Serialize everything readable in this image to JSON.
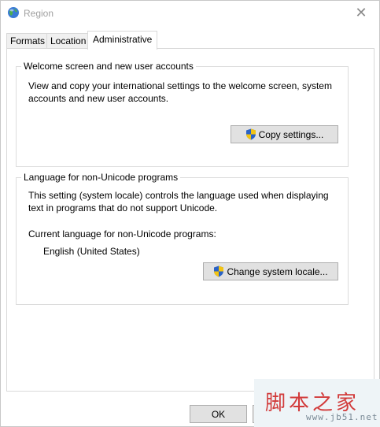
{
  "window": {
    "title": "Region",
    "close_symbol": "✕"
  },
  "tabs": [
    {
      "label": "Formats",
      "active": false
    },
    {
      "label": "Location",
      "active": false
    },
    {
      "label": "Administrative",
      "active": true
    }
  ],
  "welcome_group": {
    "title": "Welcome screen and new user accounts",
    "description_line1": "View and copy your international settings to the welcome screen, system",
    "description_line2": "accounts and new user accounts.",
    "copy_button_label": "Copy settings..."
  },
  "nonunicode_group": {
    "title": "Language for non-Unicode programs",
    "description_line1": "This setting (system locale) controls the language used when displaying",
    "description_line2": "text in programs that do not support Unicode.",
    "current_label": "Current language for non-Unicode programs:",
    "current_value": "English (United States)",
    "change_button_label": "Change system locale..."
  },
  "footer": {
    "ok_label": "OK"
  },
  "watermark": {
    "text_cn": "脚本之家",
    "url": "www.jb51.net"
  },
  "icons": {
    "title_icon": "globe-icon",
    "shield": "uac-shield-icon"
  },
  "colors": {
    "shield_blue": "#2b63c6",
    "shield_yellow": "#f3c413",
    "watermark_red": "#d23b3b"
  }
}
